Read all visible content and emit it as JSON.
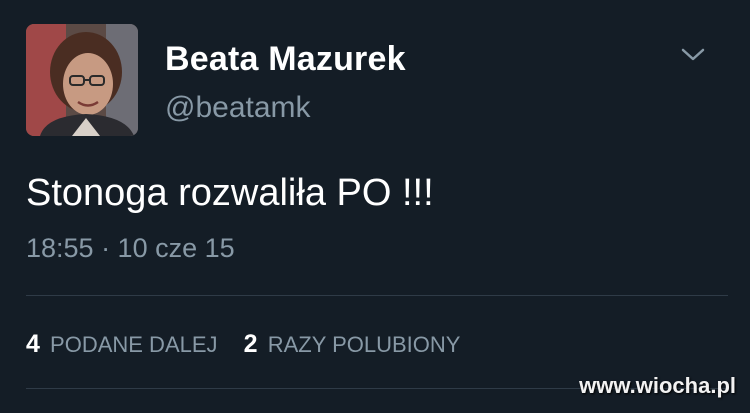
{
  "tweet": {
    "author_name": "Beata Mazurek",
    "handle": "@beatamk",
    "text": "Stonoga rozwaliła PO !!!",
    "timestamp": "18:55 · 10 cze 15",
    "stats": {
      "retweets_count": "4",
      "retweets_label": "PODANE DALEJ",
      "likes_count": "2",
      "likes_label": "RAZY POLUBIONY"
    },
    "menu_icon": "chevron-down-icon"
  },
  "watermark": "www.wiocha.pl",
  "colors": {
    "background": "#141d26",
    "primary_text": "#ffffff",
    "secondary_text": "#8899a6",
    "divider": "#2f3b47"
  }
}
